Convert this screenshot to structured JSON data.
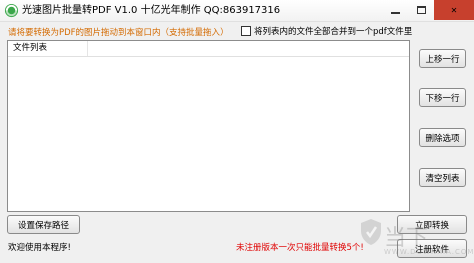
{
  "window": {
    "title": "光速图片批量转PDF V1.0 十亿光年制作 QQ:863917316"
  },
  "top": {
    "hint": "请将要转换为PDF的图片拖动到本窗口内（支持批量拖入）",
    "merge_checkbox_label": "将列表内的文件全部合并到一个pdf文件里",
    "merge_checked": false
  },
  "file_list": {
    "columns": [
      "文件列表"
    ],
    "rows": []
  },
  "buttons": {
    "move_up": "上移一行",
    "move_down": "下移一行",
    "delete_item": "删除选项",
    "clear_list": "清空列表",
    "set_save_path": "设置保存路径",
    "convert_now": "立即转换",
    "register": "注册软件"
  },
  "status": {
    "welcome": "欢迎使用本程序!",
    "notice": "未注册版本一次只能批量转换5个!"
  },
  "watermark": {
    "text": "当下",
    "sub": "WWW.DOWNXIA.COM"
  },
  "colors": {
    "hint_orange": "#d46a00",
    "notice_red": "#e00000",
    "close_button": "#c7402d"
  }
}
